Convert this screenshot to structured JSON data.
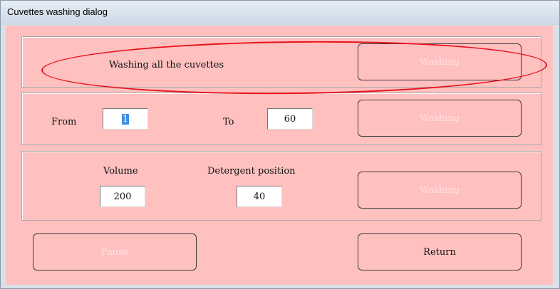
{
  "window": {
    "title": "Cuvettes washing dialog"
  },
  "section_all": {
    "label": "Washing all the cuvettes",
    "button": "Washing"
  },
  "section_range": {
    "from_label": "From",
    "from_value": "1",
    "to_label": "To",
    "to_value": "60",
    "button": "Washing"
  },
  "section_volume": {
    "volume_label": "Volume",
    "volume_value": "200",
    "detergent_label": "Detergent position",
    "detergent_value": "40",
    "button": "Washing"
  },
  "footer": {
    "pause": "Pause",
    "return": "Return"
  },
  "colors": {
    "dialog_background": "#ffc0c0",
    "annotation_ellipse": "#e8111b",
    "selection": "#3d8ee6"
  }
}
